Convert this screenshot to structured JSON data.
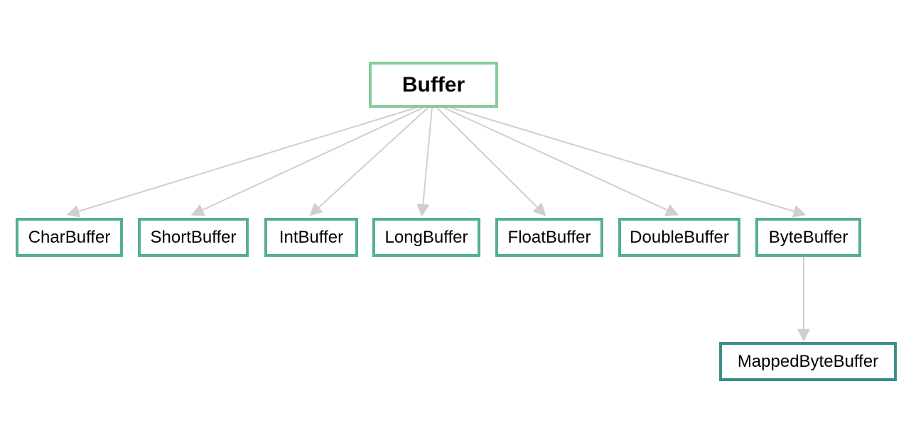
{
  "root": {
    "label": "Buffer"
  },
  "children": [
    {
      "label": "CharBuffer"
    },
    {
      "label": "ShortBuffer"
    },
    {
      "label": "IntBuffer"
    },
    {
      "label": "LongBuffer"
    },
    {
      "label": "FloatBuffer"
    },
    {
      "label": "DoubleBuffer"
    },
    {
      "label": "ByteBuffer"
    }
  ],
  "grandchild": {
    "label": "MappedByteBuffer"
  }
}
